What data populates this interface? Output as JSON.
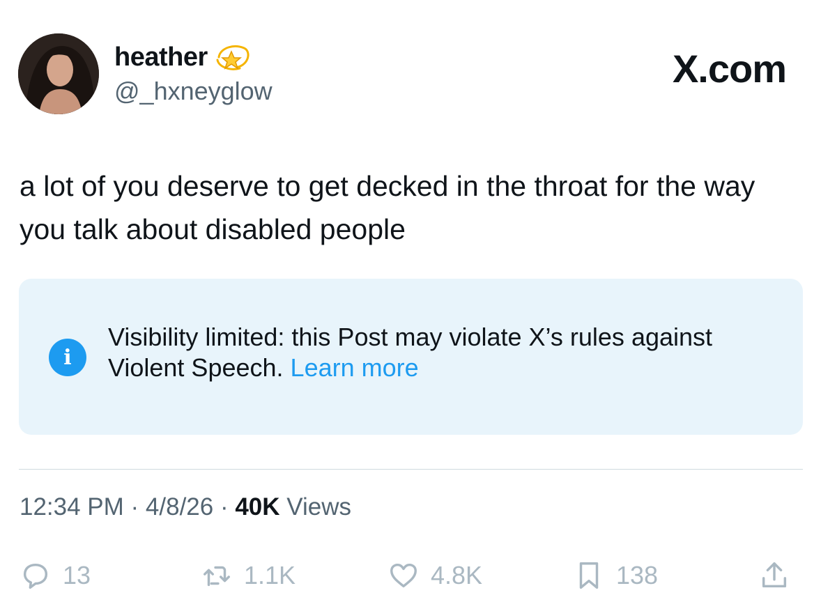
{
  "author": {
    "display_name": "heather",
    "handle": "@_hxneyglow",
    "name_emoji": "dizzy-star-emoji"
  },
  "brand": {
    "text": "X.com"
  },
  "post": {
    "text": "a lot of you deserve to get decked in the throat for the way you talk about disabled people"
  },
  "notice": {
    "text": "Visibility limited: this Post may violate X’s rules against Violent Speech.",
    "link_label": "Learn more",
    "icon": "info-icon"
  },
  "meta": {
    "time": "12:34 PM",
    "sep1": " · ",
    "date": "4/8/26",
    "sep2": " · ",
    "views_count": "40K",
    "views_label": " Views"
  },
  "actions": {
    "replies": "13",
    "reposts": "1.1K",
    "likes": "4.8K",
    "bookmarks": "138"
  },
  "colors": {
    "accent": "#1d9bf0",
    "secondary_text": "#536471",
    "notice_bg": "#e8f4fb",
    "action_icons": "#aab8c2"
  }
}
